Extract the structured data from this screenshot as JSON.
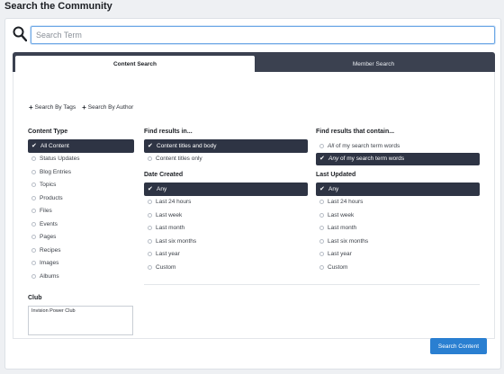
{
  "page": {
    "title": "Search the Community"
  },
  "search": {
    "placeholder": "Search Term",
    "value": ""
  },
  "tabs": [
    {
      "label": "Content Search",
      "active": true
    },
    {
      "label": "Member Search",
      "active": false
    }
  ],
  "links": {
    "by_tags": "Search By Tags",
    "by_author": "Search By Author"
  },
  "content_type": {
    "title": "Content Type",
    "options": [
      "All Content",
      "Status Updates",
      "Blog Entries",
      "Topics",
      "Products",
      "Files",
      "Events",
      "Pages",
      "Recipes",
      "Images",
      "Albums"
    ],
    "selected": 0
  },
  "club": {
    "title": "Club",
    "items": [
      "Invision Power Club"
    ]
  },
  "find_in": {
    "title": "Find results in...",
    "options": [
      "Content titles and body",
      "Content titles only"
    ],
    "selected": 0
  },
  "find_contain": {
    "title": "Find results that contain...",
    "options": [
      {
        "emph": "All",
        "rest": " of my search term words"
      },
      {
        "emph": "Any",
        "rest": " of my search term words"
      }
    ],
    "selected": 1
  },
  "date_created": {
    "title": "Date Created",
    "options": [
      "Any",
      "Last 24 hours",
      "Last week",
      "Last month",
      "Last six months",
      "Last year",
      "Custom"
    ],
    "selected": 0
  },
  "last_updated": {
    "title": "Last Updated",
    "options": [
      "Any",
      "Last 24 hours",
      "Last week",
      "Last month",
      "Last six months",
      "Last year",
      "Custom"
    ],
    "selected": 0
  },
  "submit": {
    "label": "Search Content"
  },
  "colors": {
    "accent": "#2a7fd1",
    "selected_bg": "#2e3444",
    "tab_bar": "#3b4150"
  }
}
